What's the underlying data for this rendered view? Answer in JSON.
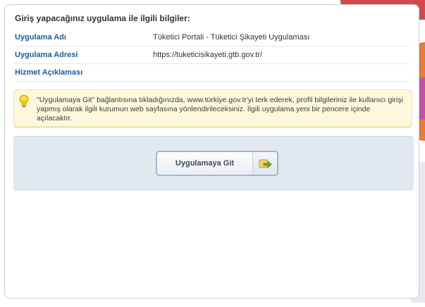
{
  "section": {
    "title": "Giriş yapacağınız uygulama ile ilgili bilgiler:"
  },
  "details": [
    {
      "label": "Uygulama Adı",
      "value": "Tüketici Portali - Tüketici Şikayeti Uygulaması"
    },
    {
      "label": "Uygulama Adresi",
      "value": "https://tuketicisikayeti.gtb.gov.tr/"
    },
    {
      "label": "Hizmet Açıklaması",
      "value": ""
    }
  ],
  "info": {
    "icon": "lightbulb-icon",
    "message": "\"Uygulamaya Git\" bağlantısına tıkladığınızda, www.türkiye.gov.tr'yi terk ederek, profil bilgileriniz ile kullanıcı girişi yapmış olarak ilgili kurumun web sayfasına yönlendirileceksiniz. İlgili uygulama yeni bir pencere içinde açılacaktır."
  },
  "action": {
    "button_label": "Uygulamaya Git",
    "button_icon": "go-arrow-icon"
  },
  "colors": {
    "label_blue": "#1f5c99",
    "info_bg": "#fdf8dc",
    "action_bg": "#e2e8ef",
    "button_border": "#9fb7d0"
  }
}
